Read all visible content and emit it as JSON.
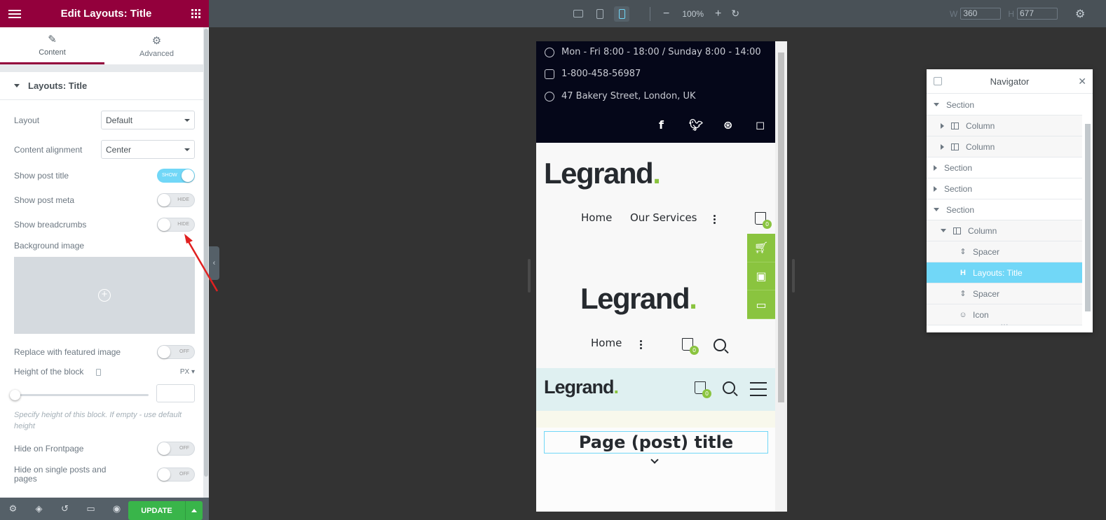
{
  "panel": {
    "title": "Edit Layouts: Title",
    "tabs": [
      {
        "label": "Content",
        "icon": "pencil-icon"
      },
      {
        "label": "Advanced",
        "icon": "gear-icon"
      }
    ],
    "section_title": "Layouts: Title",
    "controls": {
      "layout": {
        "label": "Layout",
        "value": "Default"
      },
      "content_alignment": {
        "label": "Content alignment",
        "value": "Center"
      },
      "show_post_title": {
        "label": "Show post title",
        "state": "SHOW"
      },
      "show_post_meta": {
        "label": "Show post meta",
        "state": "HIDE"
      },
      "show_breadcrumbs": {
        "label": "Show breadcrumbs",
        "state": "HIDE"
      },
      "background_image": {
        "label": "Background image"
      },
      "replace_featured": {
        "label": "Replace with featured image",
        "state": "OFF"
      },
      "height_block": {
        "label": "Height of the block",
        "unit": "PX",
        "value": ""
      },
      "height_help": "Specify height of this block. If empty - use default height",
      "hide_frontpage": {
        "label": "Hide on Frontpage",
        "state": "OFF"
      },
      "hide_single": {
        "label": "Hide on single posts and pages",
        "state": "OFF"
      }
    },
    "footer": {
      "update_label": "UPDATE"
    }
  },
  "topbar": {
    "zoom": "100%",
    "width_label": "W",
    "width_value": "360",
    "height_label": "H",
    "height_value": "677"
  },
  "preview": {
    "hours": "Mon - Fri 8:00 - 18:00 / Sunday 8:00 - 14:00",
    "phone": "1-800-458-56987",
    "address": "47 Bakery Street, London, UK",
    "logo_text": "Legrand",
    "logo_dot": ".",
    "nav1": [
      "Home",
      "Our Services"
    ],
    "nav2": [
      "Home"
    ],
    "cart_count": "0",
    "page_title": "Page (post) title"
  },
  "navigator": {
    "title": "Navigator",
    "items": [
      {
        "label": "Section",
        "level": 0,
        "expanded": true
      },
      {
        "label": "Column",
        "level": 1,
        "expanded": false
      },
      {
        "label": "Column",
        "level": 1,
        "expanded": false
      },
      {
        "label": "Section",
        "level": 0,
        "expanded": false
      },
      {
        "label": "Section",
        "level": 0,
        "expanded": false
      },
      {
        "label": "Section",
        "level": 0,
        "expanded": true
      },
      {
        "label": "Column",
        "level": 1,
        "expanded": true
      },
      {
        "label": "Spacer",
        "level": 2
      },
      {
        "label": "Layouts: Title",
        "level": 2,
        "active": true
      },
      {
        "label": "Spacer",
        "level": 2
      },
      {
        "label": "Icon",
        "level": 2
      }
    ]
  },
  "colors": {
    "brand": "#93003c",
    "accent": "#71d7f7",
    "green": "#8ac43f",
    "update": "#39b54a"
  }
}
